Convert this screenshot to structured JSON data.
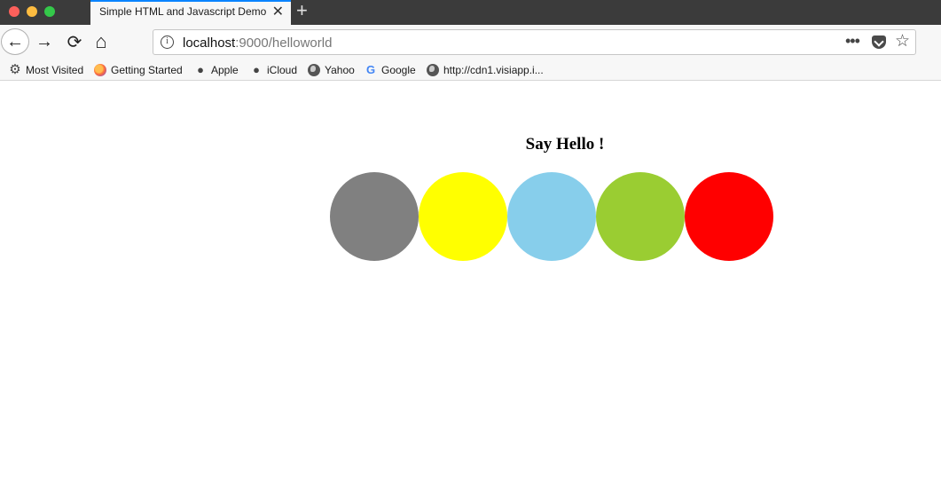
{
  "browser": {
    "tab": {
      "title": "Simple HTML and Javascript Demo",
      "close_glyph": "✕"
    },
    "new_tab_glyph": "+",
    "nav": {
      "back_glyph": "←",
      "forward_glyph": "→",
      "reload_glyph": "⟳",
      "home_glyph": "⌂"
    },
    "url": {
      "info_glyph": "i",
      "host": "localhost",
      "path": ":9000/helloworld",
      "more_glyph": "•••",
      "star_glyph": "☆"
    },
    "bookmarks": [
      {
        "label": "Most Visited",
        "icon": "gear-icon",
        "glyph": "⚙"
      },
      {
        "label": "Getting Started",
        "icon": "firefox-icon",
        "glyph": ""
      },
      {
        "label": "Apple",
        "icon": "apple-icon",
        "glyph": ""
      },
      {
        "label": "iCloud",
        "icon": "apple-icon",
        "glyph": ""
      },
      {
        "label": "Yahoo",
        "icon": "globe-icon",
        "glyph": ""
      },
      {
        "label": "Google",
        "icon": "google-icon",
        "glyph": "G"
      },
      {
        "label": "http://cdn1.visiapp.i...",
        "icon": "globe-icon",
        "glyph": ""
      }
    ]
  },
  "page": {
    "heading": "Say Hello !",
    "circles": [
      {
        "color": "#808080"
      },
      {
        "color": "#ffff00"
      },
      {
        "color": "#87ceeb"
      },
      {
        "color": "#9acd32"
      },
      {
        "color": "#ff0000"
      }
    ]
  }
}
